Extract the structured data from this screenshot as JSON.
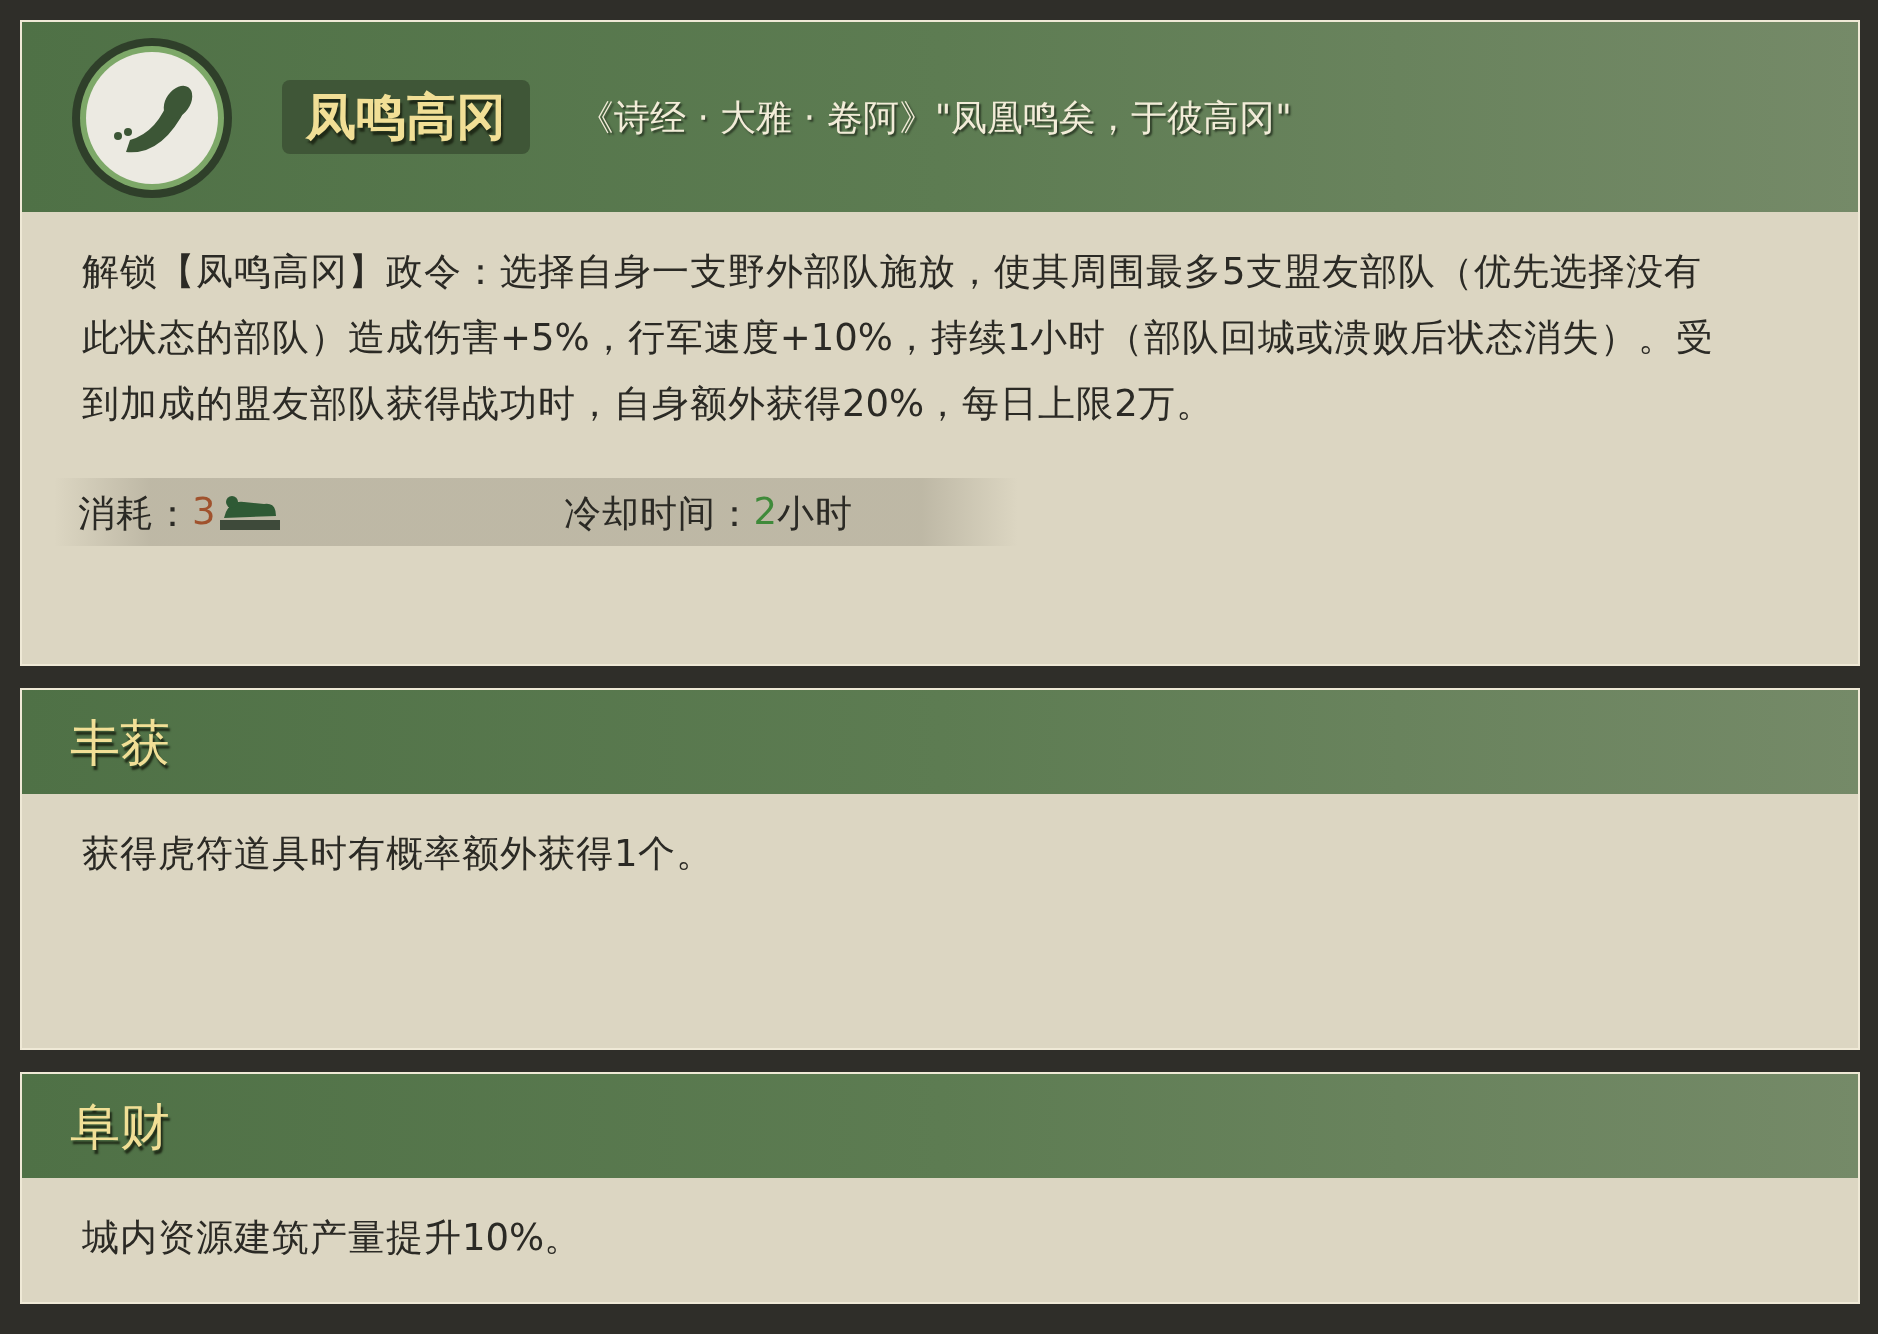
{
  "main_skill": {
    "name": "凤鸣高冈",
    "quote": "《诗经 · 大雅 · 卷阿》\"凤凰鸣矣，于彼高冈\"",
    "description": "解锁【凤鸣高冈】政令：选择自身一支野外部队施放，使其周围最多5支盟友部队（优先选择没有此状态的部队）造成伤害+5%，行军速度+10%，持续1小时（部队回城或溃败后状态消失）。受到加成的盟友部队获得战功时，自身额外获得20%，每日上限2万。",
    "cost_label": "消耗：",
    "cost_value": "3",
    "cooldown_label": "冷却时间：",
    "cooldown_value": "2",
    "cooldown_unit": "小时"
  },
  "skills": [
    {
      "name": "丰获",
      "description": "获得虎符道具时有概率额外获得1个。"
    },
    {
      "name": "阜财",
      "description": "城内资源建筑产量提升10%。"
    }
  ]
}
